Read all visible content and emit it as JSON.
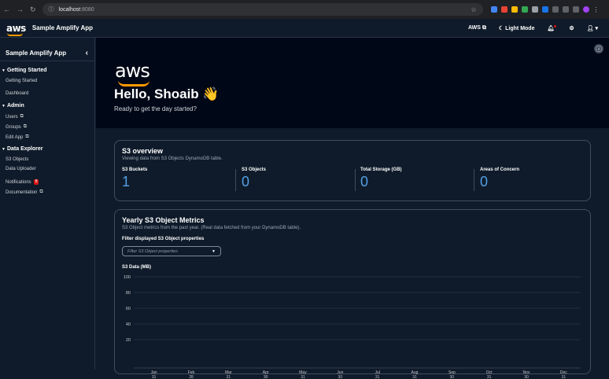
{
  "browser": {
    "host": "localhost",
    "port": ":8080"
  },
  "topnav": {
    "logo": "aws",
    "app_name": "Sample Amplify App",
    "aws_link": "AWS",
    "mode_toggle": "Light Mode"
  },
  "sidebar": {
    "title": "Sample Amplify App",
    "sections": [
      {
        "label": "Getting Started",
        "items": [
          {
            "label": "Getting Started"
          },
          {
            "label": "Dashboard"
          }
        ]
      },
      {
        "label": "Admin",
        "items": [
          {
            "label": "Users"
          },
          {
            "label": "Groups"
          },
          {
            "label": "Edit App"
          }
        ]
      },
      {
        "label": "Data Explorer",
        "items": [
          {
            "label": "S3 Objects"
          },
          {
            "label": "Data Uploader"
          }
        ]
      }
    ],
    "notifications": {
      "label": "Notifications",
      "count": "8"
    },
    "documentation": "Documentation"
  },
  "hero": {
    "logo": "aws",
    "greeting": "Hello, Shoaib 👋",
    "subtitle": "Ready to get the day started?"
  },
  "overview": {
    "title": "S3 overview",
    "description": "Viewing data from S3 Objects DynamoDB table.",
    "metrics": [
      {
        "label": "S3 Buckets",
        "value": "1"
      },
      {
        "label": "S3 Objects",
        "value": "0"
      },
      {
        "label": "Total Storage (GB)",
        "value": "0"
      },
      {
        "label": "Areas of Concern",
        "value": "0"
      }
    ]
  },
  "metrics_card": {
    "title": "Yearly S3 Object Metrics",
    "description": "S3 Object metrics from the past year. (Real data fetched from your DynamoDB table).",
    "filter_label": "Filter displayed S3 Object properties",
    "filter_placeholder": "Filter S3 Object properties"
  },
  "chart_data": {
    "type": "line",
    "ylabel": "S3 Data (MB)",
    "ylim": [
      0,
      100
    ],
    "yticks": [
      "100",
      "80",
      "60",
      "40",
      "20"
    ],
    "categories": [
      {
        "top": "Jan",
        "bottom": "31"
      },
      {
        "top": "Feb",
        "bottom": "28"
      },
      {
        "top": "Mar",
        "bottom": "31"
      },
      {
        "top": "Apr",
        "bottom": "30"
      },
      {
        "top": "May",
        "bottom": "31"
      },
      {
        "top": "Jun",
        "bottom": "30"
      },
      {
        "top": "Jul",
        "bottom": "31"
      },
      {
        "top": "Aug",
        "bottom": "31"
      },
      {
        "top": "Sep",
        "bottom": "30"
      },
      {
        "top": "Oct",
        "bottom": "31"
      },
      {
        "top": "Nov",
        "bottom": "30"
      },
      {
        "top": "Dec",
        "bottom": "31"
      }
    ],
    "series": [],
    "grid": true
  }
}
